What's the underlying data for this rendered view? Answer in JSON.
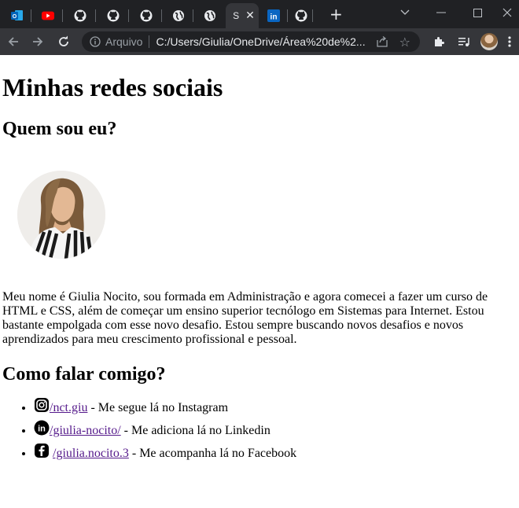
{
  "browser": {
    "tabs": [
      {
        "icon": "outlook-icon"
      },
      {
        "icon": "youtube-icon"
      },
      {
        "icon": "github-icon"
      },
      {
        "icon": "github-icon"
      },
      {
        "icon": "github-icon"
      },
      {
        "icon": "globe-icon"
      },
      {
        "icon": "globe-icon"
      },
      {
        "icon": "page-icon",
        "label": "S",
        "active": true
      },
      {
        "icon": "linkedin-icon"
      },
      {
        "icon": "github-icon"
      }
    ],
    "address_label": "Arquivo",
    "url": "C:/Users/Giulia/OneDrive/Área%20de%2..."
  },
  "page": {
    "title": "Minhas redes sociais",
    "about_heading": "Quem sou eu?",
    "bio": "Meu nome é Giulia Nocito, sou formada em Administração e agora comecei a fazer um curso de HTML e CSS, além de começar um ensino superior tecnólogo em Sistemas para Internet. Estou bastante empolgada com esse novo desafio. Estou sempre buscando novos desafios e novos aprendizados para meu crescimento profissional e pessoal.",
    "contact_heading": "Como falar comigo?",
    "links": [
      {
        "icon": "instagram-icon",
        "link_text": "/nct.giu",
        "suffix": " - Me segue lá no Instagram"
      },
      {
        "icon": "linkedin-icon",
        "link_text": "/giulia-nocito/",
        "suffix": " - Me adiciona lá no Linkedin"
      },
      {
        "icon": "facebook-icon",
        "link_text": "/giulia.nocito.3",
        "suffix": " - Me acompanha lá no Facebook"
      }
    ]
  },
  "colors": {
    "tabstrip": "#202124",
    "toolbar": "#35363a",
    "link_visited": "#551a8b"
  }
}
